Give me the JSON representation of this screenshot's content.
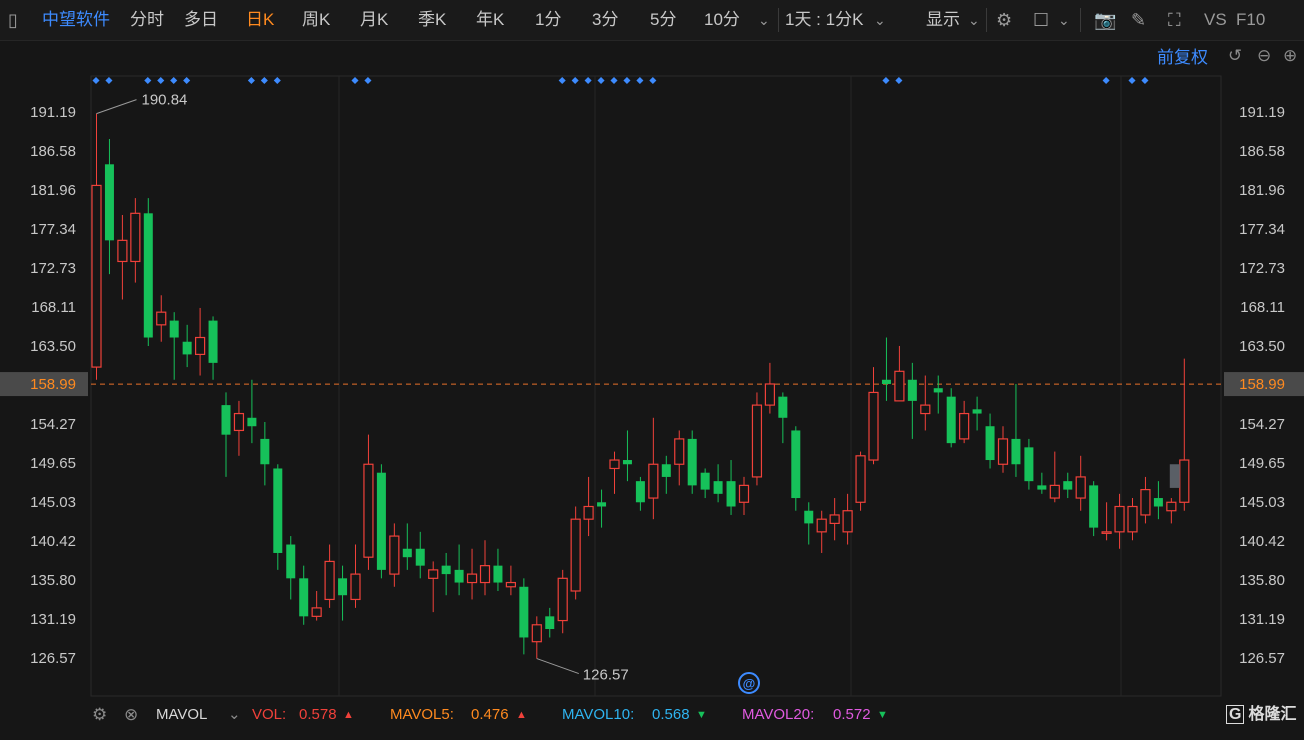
{
  "toolbar": {
    "stock_name": "中望软件",
    "periods": [
      "分时",
      "多日",
      "日K",
      "周K",
      "月K",
      "季K",
      "年K",
      "1分",
      "3分",
      "5分",
      "10分"
    ],
    "active_period": "日K",
    "interval_label": "1天 : 1分K",
    "display_label": "显示",
    "vs_label": "VS",
    "f10_label": "F10",
    "adjust_label": "前复权"
  },
  "colors": {
    "up": "#f0413a",
    "down": "#16c15a",
    "ref_line": "#e8702a",
    "accent": "#3d8bff",
    "bg": "#161616"
  },
  "chart_data": {
    "type": "candlestick",
    "yticks": [
      191.19,
      186.58,
      181.96,
      177.34,
      172.73,
      168.11,
      163.5,
      158.99,
      154.27,
      149.65,
      145.03,
      140.42,
      135.8,
      131.19,
      126.57
    ],
    "ylim": [
      123.5,
      193.5
    ],
    "current_price": 158.99,
    "high_label": "190.84",
    "low_label": "126.57",
    "candles": [
      [
        161.0,
        182.5,
        191.0,
        159.5
      ],
      [
        185.0,
        176.0,
        188.0,
        172.0
      ],
      [
        173.5,
        176.0,
        179.0,
        169.0
      ],
      [
        173.5,
        179.2,
        181.0,
        171.0
      ],
      [
        179.2,
        164.5,
        181.0,
        163.5
      ],
      [
        166.0,
        167.5,
        169.5,
        164.0
      ],
      [
        166.5,
        164.5,
        167.5,
        159.5
      ],
      [
        164.0,
        162.5,
        166.0,
        161.0
      ],
      [
        162.5,
        164.5,
        168.0,
        160.0
      ],
      [
        166.5,
        161.5,
        167.0,
        159.5
      ],
      [
        156.5,
        153.0,
        158.0,
        148.0
      ],
      [
        153.5,
        155.5,
        157.0,
        150.5
      ],
      [
        155.0,
        154.0,
        159.5,
        152.0
      ],
      [
        152.5,
        149.5,
        154.5,
        147.0
      ],
      [
        149.0,
        139.0,
        149.5,
        137.0
      ],
      [
        140.0,
        136.0,
        141.0,
        133.5
      ],
      [
        136.0,
        131.5,
        137.5,
        130.5
      ],
      [
        131.5,
        132.5,
        134.5,
        131.0
      ],
      [
        133.5,
        138.0,
        140.0,
        132.5
      ],
      [
        136.0,
        134.0,
        137.5,
        131.0
      ],
      [
        133.5,
        136.5,
        140.0,
        132.5
      ],
      [
        138.5,
        149.5,
        153.0,
        137.0
      ],
      [
        148.5,
        137.0,
        149.5,
        136.0
      ],
      [
        136.5,
        141.0,
        142.5,
        135.0
      ],
      [
        139.5,
        138.5,
        142.5,
        137.0
      ],
      [
        139.5,
        137.5,
        141.5,
        136.0
      ],
      [
        136.0,
        137.0,
        138.0,
        132.0
      ],
      [
        137.5,
        136.5,
        139.0,
        134.0
      ],
      [
        137.0,
        135.5,
        140.0,
        134.0
      ],
      [
        135.5,
        136.5,
        139.5,
        133.5
      ],
      [
        135.5,
        137.5,
        140.5,
        134.0
      ],
      [
        137.5,
        135.5,
        139.5,
        134.5
      ],
      [
        135.0,
        135.5,
        137.5,
        134.0
      ],
      [
        135.0,
        129.0,
        136.0,
        127.0
      ],
      [
        128.5,
        130.5,
        131.5,
        126.5
      ],
      [
        131.5,
        130.0,
        132.5,
        129.0
      ],
      [
        131.0,
        136.0,
        137.0,
        129.5
      ],
      [
        134.5,
        143.0,
        144.5,
        133.5
      ],
      [
        143.0,
        144.5,
        148.0,
        141.0
      ],
      [
        145.0,
        144.5,
        146.5,
        142.0
      ],
      [
        149.0,
        150.0,
        151.0,
        146.0
      ],
      [
        150.0,
        149.5,
        153.5,
        147.5
      ],
      [
        147.5,
        145.0,
        148.0,
        144.0
      ],
      [
        145.5,
        149.5,
        155.0,
        143.0
      ],
      [
        149.5,
        148.0,
        150.5,
        146.0
      ],
      [
        149.5,
        152.5,
        153.5,
        147.0
      ],
      [
        152.5,
        147.0,
        153.5,
        146.0
      ],
      [
        148.5,
        146.5,
        149.0,
        145.5
      ],
      [
        147.5,
        146.0,
        149.5,
        145.0
      ],
      [
        147.5,
        144.5,
        150.0,
        143.5
      ],
      [
        145.0,
        147.0,
        148.0,
        143.5
      ],
      [
        148.0,
        156.5,
        158.0,
        147.0
      ],
      [
        156.5,
        159.0,
        161.5,
        155.5
      ],
      [
        157.5,
        155.0,
        158.0,
        152.0
      ],
      [
        153.5,
        145.5,
        154.0,
        144.0
      ],
      [
        144.0,
        142.5,
        145.0,
        140.0
      ],
      [
        141.5,
        143.0,
        144.0,
        139.0
      ],
      [
        142.5,
        143.5,
        145.5,
        140.5
      ],
      [
        141.5,
        144.0,
        146.0,
        140.0
      ],
      [
        145.0,
        150.5,
        151.0,
        144.0
      ],
      [
        150.0,
        158.0,
        161.0,
        149.5
      ],
      [
        159.5,
        159.0,
        164.5,
        157.0
      ],
      [
        157.0,
        160.5,
        163.5,
        157.5
      ],
      [
        159.5,
        157.0,
        161.5,
        152.5
      ],
      [
        155.5,
        156.5,
        160.0,
        153.5
      ],
      [
        158.5,
        158.0,
        160.0,
        155.5
      ],
      [
        157.5,
        152.0,
        158.5,
        151.5
      ],
      [
        152.5,
        155.5,
        157.0,
        152.0
      ],
      [
        156.0,
        155.5,
        157.5,
        153.5
      ],
      [
        154.0,
        150.0,
        155.5,
        149.0
      ],
      [
        149.5,
        152.5,
        154.0,
        148.5
      ],
      [
        152.5,
        149.5,
        159.0,
        148.0
      ],
      [
        151.5,
        147.5,
        152.5,
        146.5
      ],
      [
        147.0,
        146.5,
        148.5,
        146.0
      ],
      [
        145.5,
        147.0,
        151.0,
        145.0
      ],
      [
        147.5,
        146.5,
        148.5,
        145.5
      ],
      [
        145.5,
        148.0,
        150.5,
        144.0
      ],
      [
        147.0,
        142.0,
        147.5,
        141.0
      ],
      [
        141.5,
        141.5,
        145.0,
        140.5
      ],
      [
        141.5,
        144.5,
        146.0,
        139.5
      ],
      [
        141.5,
        144.5,
        145.5,
        140.5
      ],
      [
        143.5,
        146.5,
        148.0,
        142.5
      ],
      [
        145.5,
        144.5,
        147.5,
        143.0
      ],
      [
        144.0,
        145.0,
        145.5,
        142.5
      ],
      [
        145.0,
        150.0,
        162.0,
        144.0
      ]
    ],
    "markers": [
      0,
      1,
      4,
      5,
      6,
      7,
      12,
      13,
      14,
      20,
      21,
      36,
      37,
      38,
      39,
      40,
      41,
      42,
      43,
      61,
      62,
      78,
      80,
      81
    ],
    "mavol": {
      "name": "MAVOL",
      "vol_label": "VOL:",
      "vol_value": "0.578",
      "mavol5_label": "MAVOL5:",
      "mavol5_value": "0.476",
      "mavol10_label": "MAVOL10:",
      "mavol10_value": "0.568",
      "mavol20_label": "MAVOL20:",
      "mavol20_value": "0.572"
    }
  },
  "watermark": "格隆汇"
}
